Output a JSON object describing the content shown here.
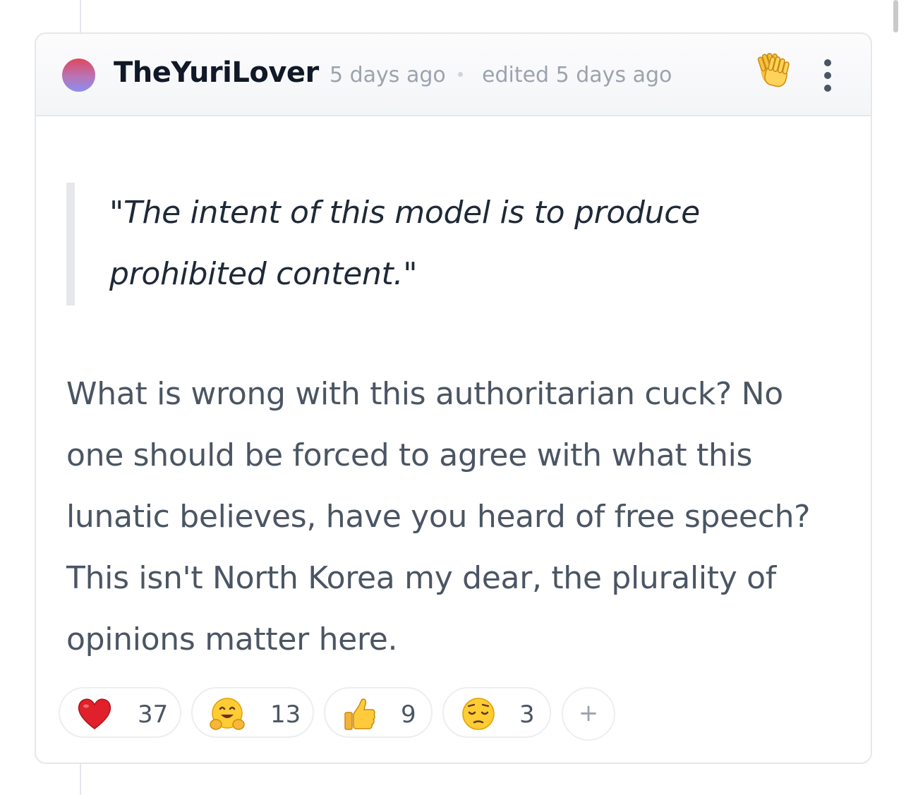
{
  "comment": {
    "username": "TheYuriLover",
    "timestamp": "5 days ago",
    "edited": "edited 5 days ago",
    "quote": "\"The intent of this model is to produce prohibited content.\"",
    "body": "What is wrong with this authoritarian cuck? No one should be forced to agree with what this lunatic believes, have you heard of free speech? This isn't North Korea my dear, the plurality of opinions matter here.",
    "header_icons": [
      "clapping-hands-icon",
      "more-options-icon"
    ]
  },
  "reactions": [
    {
      "emoji": "heart",
      "count": "37"
    },
    {
      "emoji": "hugging-face",
      "count": "13"
    },
    {
      "emoji": "thumbs-up",
      "count": "9"
    },
    {
      "emoji": "pensive-face",
      "count": "3"
    }
  ],
  "add_reaction_label": "+",
  "colors": {
    "avatar_top": "#e0485d",
    "avatar_bottom": "#8b8ff0",
    "text_dark": "#111827",
    "text_muted": "#9ca3af",
    "body_text": "#4b5563",
    "border": "#e5e7eb"
  }
}
